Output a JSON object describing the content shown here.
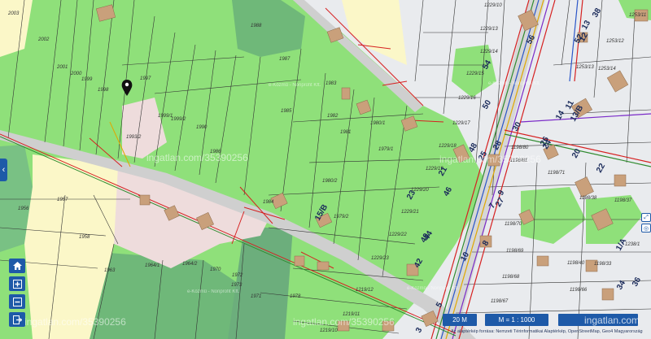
{
  "map": {
    "watermark": "ingatlan.com/35390256",
    "provider_label": "e-Közmű - Nonprofit Kft.",
    "parcels": [
      "2003",
      "2002",
      "2001",
      "2000",
      "1999",
      "1998",
      "1997",
      "1988",
      "1987",
      "1983",
      "1985",
      "1982",
      "1981",
      "1980/1",
      "1979/1",
      "1999/1",
      "1999/2",
      "1990",
      "1993/2",
      "1986",
      "1984",
      "1980/2",
      "1979/2",
      "1957",
      "1956",
      "1958",
      "1963",
      "1964/1",
      "1964/2",
      "1970",
      "1972",
      "1973",
      "1971",
      "1978",
      "1229/10",
      "1229/13",
      "1229/14",
      "1229/15",
      "1229/16",
      "1229/17",
      "1229/18",
      "1229/19",
      "1229/20",
      "1229/21",
      "1229/22",
      "1229/23",
      "1219/12",
      "1219/11",
      "1219/10",
      "1198/80",
      "1198/81",
      "1198/71",
      "1198/70",
      "1198/38",
      "1198/69",
      "1198/68",
      "1198/67",
      "1198/66",
      "1198/40",
      "1198/37",
      "1198/33",
      "1253/11",
      "1253/12",
      "1253/13",
      "1253/14",
      "1238/1"
    ],
    "house_numbers": [
      "56",
      "54",
      "52",
      "50",
      "48",
      "46",
      "44",
      "42",
      "40",
      "38",
      "36",
      "34",
      "30",
      "28",
      "26",
      "24",
      "22",
      "20",
      "14",
      "13",
      "12",
      "11",
      "10",
      "9",
      "8",
      "7",
      "5",
      "3",
      "1/A",
      "21",
      "23",
      "25",
      "27",
      "15/B",
      "13/B"
    ]
  },
  "controls": {
    "home_icon": "home-icon",
    "zoom_in_icon": "plus-square-icon",
    "zoom_out_icon": "minus-square-icon",
    "exit_icon": "exit-icon",
    "side_toggle": "‹"
  },
  "bottom": {
    "scale": "20 M",
    "ratio": "M = 1 : 1000",
    "brand": "ingatlan.com",
    "attribution": "Az alaptérkép forrása: Nemzeti Térinformatikai Alaptérkép, OpenStreetMap, Geo4 Magyarország"
  },
  "colors": {
    "light_green": "#8fe07a",
    "dark_green": "#6fb879",
    "pale_yellow": "#fbf7c8",
    "light_pink": "#eedcdc",
    "grey_parcel": "#e9ebee",
    "road": "#c9c9c9",
    "building": "#c9a07b",
    "accent_blue": "#1e5aa8",
    "utility_red": "#d62020"
  }
}
